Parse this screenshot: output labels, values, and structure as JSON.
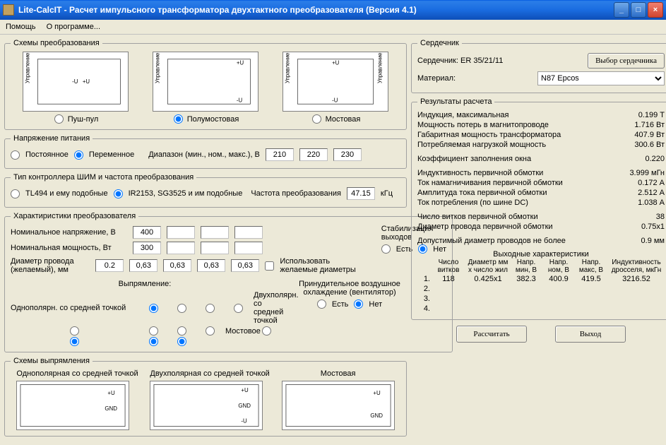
{
  "window": {
    "title": "Lite-CalcIT - Расчет импульсного трансформатора двухтактного преобразователя (Версия 4.1)"
  },
  "menu": {
    "help": "Помощь",
    "about": "О программе..."
  },
  "schemes": {
    "legend": "Схемы преобразования",
    "s1": "Пуш-пул",
    "s2": "Полумостовая",
    "s3": "Мостовая"
  },
  "supply": {
    "legend": "Напряжение питания",
    "const": "Постоянное",
    "alt": "Переменное",
    "range_label": "Диапазон (мин., ном., макс.), В",
    "v_min": "210",
    "v_nom": "220",
    "v_max": "230"
  },
  "pwm": {
    "legend": "Тип контроллера ШИМ и частота преобразования",
    "tl494": "TL494 и ему подобные",
    "ir2153": "IR2153, SG3525 и им подобные",
    "freq_label": "Частота преобразования",
    "freq": "47.15",
    "freq_unit": "кГц"
  },
  "conv": {
    "legend": "Характиристики преобразователя",
    "nom_v": "Номинальное напряжение, В",
    "nom_v_val": "400",
    "nom_p": "Номинальная мощность, Вт",
    "nom_p_val": "300",
    "wire": "Диаметр провода (желаемый), мм",
    "d0": "0.2",
    "d1": "0,63",
    "d2": "0,63",
    "d3": "0,63",
    "d4": "0,63",
    "use_wanted": "Использовать желаемые диаметры",
    "stab_legend": "Стабилизация выходов",
    "yes": "Есть",
    "no": "Нет",
    "rect_legend": "Выпрямление:",
    "r1": "Однополярн. со средней точкой",
    "r2": "Двухполярн. со средней точкой",
    "r3": "Мостовое",
    "cool_legend": "Принудительное воздушное охлаждение (вентилятор)"
  },
  "rect": {
    "legend": "Схемы выпрямления",
    "s1": "Однополярная со средней точкой",
    "s2": "Двухполярная со средней точкой",
    "s3": "Мостовая"
  },
  "core": {
    "legend": "Сердечник",
    "label": "Сердечник:",
    "value": "ER 35/21/11",
    "btn": "Выбор сердечника",
    "mat_label": "Материал:",
    "mat_value": "N87 Epcos"
  },
  "res": {
    "legend": "Результаты расчeта",
    "r1l": "Индукция, максимальная",
    "r1v": "0.199 Т",
    "r2l": "Мощность потерь в магнитопроводе",
    "r2v": "1.716 Вт",
    "r3l": "Габаритная мощность трансформатора",
    "r3v": "407.9 Вт",
    "r4l": "Потребляемая нагрузкой мощность",
    "r4v": "300.6 Вт",
    "r5l": "Коэффициент заполнения окна",
    "r5v": "0.220",
    "r6l": "Индуктивность первичной обмотки",
    "r6v": "3.999 мГн",
    "r7l": "Ток намагничивания первичной обмотки",
    "r7v": "0.172 А",
    "r8l": "Амплитуда тока первичной обмотки",
    "r8v": "2.512 А",
    "r9l": "Ток потребления (по шине DC)",
    "r9v": "1.038 А",
    "r10l": "Число витков первичной обмотки",
    "r10v": "38",
    "r11l": "Диаметр провода первичной обмотки",
    "r11v": "0.75x1",
    "r12l": "Допустимый диаметр проводов не более",
    "r12v": "0.9 мм",
    "out_legend": "Выходные характеристики",
    "h1": "Число витков",
    "h2": "Диаметр мм x число жил",
    "h3": "Напр. мин, В",
    "h4": "Напр. ном, В",
    "h5": "Напр. макс, В",
    "h6": "Индуктивность дросселя, мкГн",
    "o1": {
      "n": "1.",
      "turns": "118",
      "dia": "0.425x1",
      "vmin": "382.3",
      "vnom": "400.9",
      "vmax": "419.5",
      "ind": "3216.52"
    },
    "o2n": "2.",
    "o3n": "3.",
    "o4n": "4."
  },
  "btns": {
    "calc": "Рассчитать",
    "exit": "Выход"
  }
}
